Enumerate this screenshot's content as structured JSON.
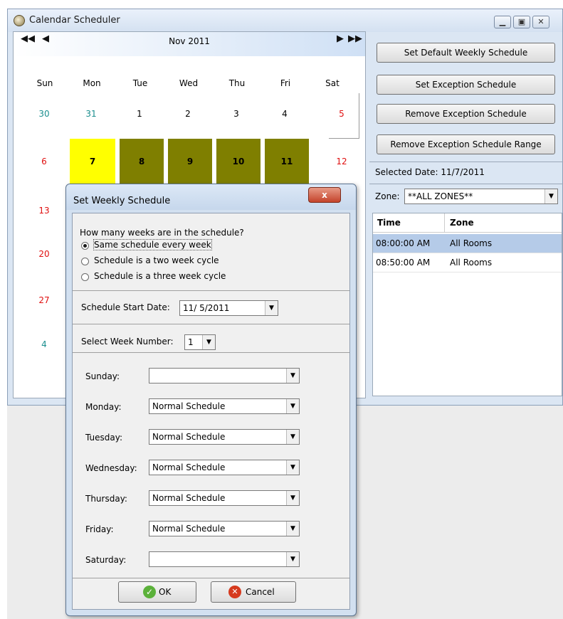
{
  "window": {
    "title": "Calendar Scheduler"
  },
  "calendar": {
    "month_label": "Nov 2011",
    "days_of_week": [
      "Sun",
      "Mon",
      "Tue",
      "Wed",
      "Thu",
      "Fri",
      "Sat"
    ],
    "row1": [
      "30",
      "31",
      "1",
      "2",
      "3",
      "4",
      "5"
    ],
    "row2": [
      "6",
      "7",
      "8",
      "9",
      "10",
      "11",
      "12"
    ],
    "col_sun": [
      "13",
      "20",
      "27",
      "4"
    ]
  },
  "right_panel": {
    "buttons": [
      "Set Default Weekly Schedule",
      "Set Exception Schedule",
      "Remove Exception Schedule",
      "Remove Exception Schedule Range"
    ],
    "selected_date": "Selected Date: 11/7/2011",
    "zone_label": "Zone:",
    "zone_value": "**ALL ZONES**",
    "grid_headers": [
      "Time",
      "Zone"
    ],
    "grid_rows": [
      {
        "time": "08:00:00 AM",
        "zone": "All Rooms"
      },
      {
        "time": "08:50:00 AM",
        "zone": "All Rooms"
      }
    ]
  },
  "dialog": {
    "title": "Set Weekly Schedule",
    "close": "x",
    "question": "How many weeks are in the schedule?",
    "options": [
      "Same schedule every week",
      "Schedule is a two week cycle",
      "Schedule is a three week cycle"
    ],
    "start_date_label": "Schedule Start Date:",
    "start_date_value": "11/ 5/2011",
    "week_number_label": "Select Week Number:",
    "week_number_value": "1",
    "days": [
      {
        "label": "Sunday:",
        "value": ""
      },
      {
        "label": "Monday:",
        "value": "Normal Schedule"
      },
      {
        "label": "Tuesday:",
        "value": "Normal Schedule"
      },
      {
        "label": "Wednesday:",
        "value": "Normal Schedule"
      },
      {
        "label": "Thursday:",
        "value": "Normal Schedule"
      },
      {
        "label": "Friday:",
        "value": "Normal Schedule"
      },
      {
        "label": "Saturday:",
        "value": ""
      }
    ],
    "ok_label": "OK",
    "cancel_label": "Cancel"
  }
}
